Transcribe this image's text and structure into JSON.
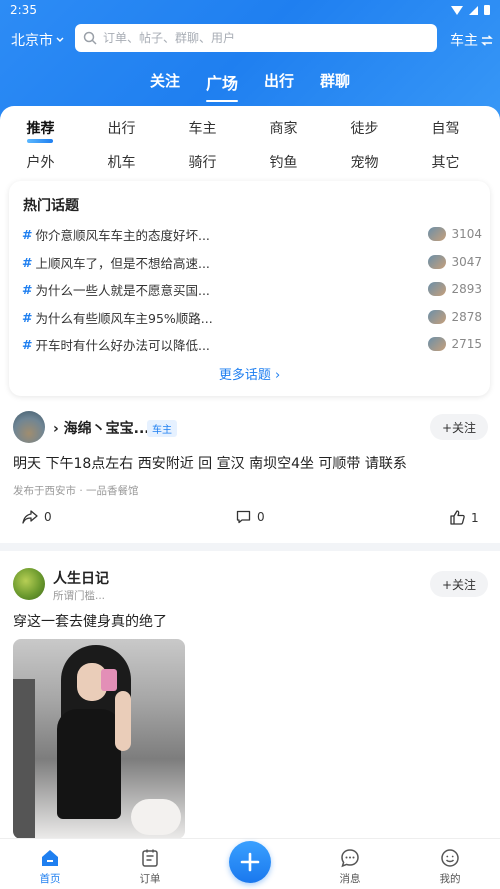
{
  "status": {
    "time": "2:35"
  },
  "header": {
    "city": "北京市",
    "search_placeholder": "订单、帖子、群聊、用户",
    "role": "车主"
  },
  "main_tabs": [
    {
      "label": "关注",
      "active": false
    },
    {
      "label": "广场",
      "active": true
    },
    {
      "label": "出行",
      "active": false
    },
    {
      "label": "群聊",
      "active": false
    }
  ],
  "categories": [
    [
      "推荐",
      "出行",
      "车主",
      "商家",
      "徒步",
      "自驾"
    ],
    [
      "户外",
      "机车",
      "骑行",
      "钓鱼",
      "宠物",
      "其它"
    ]
  ],
  "hot_topics": {
    "title": "热门话题",
    "items": [
      {
        "text": "你介意顺风车车主的态度好坏...",
        "count": "3104"
      },
      {
        "text": "上顺风车了，但是不想给高速...",
        "count": "3047"
      },
      {
        "text": "为什么一些人就是不愿意买国...",
        "count": "2893"
      },
      {
        "text": "为什么有些顺风车主95%顺路...",
        "count": "2878"
      },
      {
        "text": "开车时有什么好办法可以降低...",
        "count": "2715"
      }
    ],
    "more": "更多话题 ›"
  },
  "posts": [
    {
      "name": "› 海绵丶宝宝...",
      "tag": "车主",
      "follow": "+关注",
      "text": "明天 下午18点左右 西安附近 回 宣汉 南坝空4坐 可顺带 请联系",
      "meta": "发布于西安市 · 一品香餐馆",
      "share_count": "0",
      "comment_count": "0",
      "like_count": "1"
    },
    {
      "name": "人生日记",
      "sub": "所谓门槛...",
      "follow": "+关注",
      "text": "穿这一套去健身真的绝了"
    }
  ],
  "bottom_nav": [
    {
      "label": "首页",
      "active": true,
      "icon": "home-icon"
    },
    {
      "label": "订单",
      "active": false,
      "icon": "order-icon"
    },
    {
      "label": "消息",
      "active": false,
      "icon": "message-icon"
    },
    {
      "label": "我的",
      "active": false,
      "icon": "profile-icon"
    }
  ],
  "colors": {
    "brand": "#1f7ff0",
    "page_bg": "#f2f4f7"
  }
}
